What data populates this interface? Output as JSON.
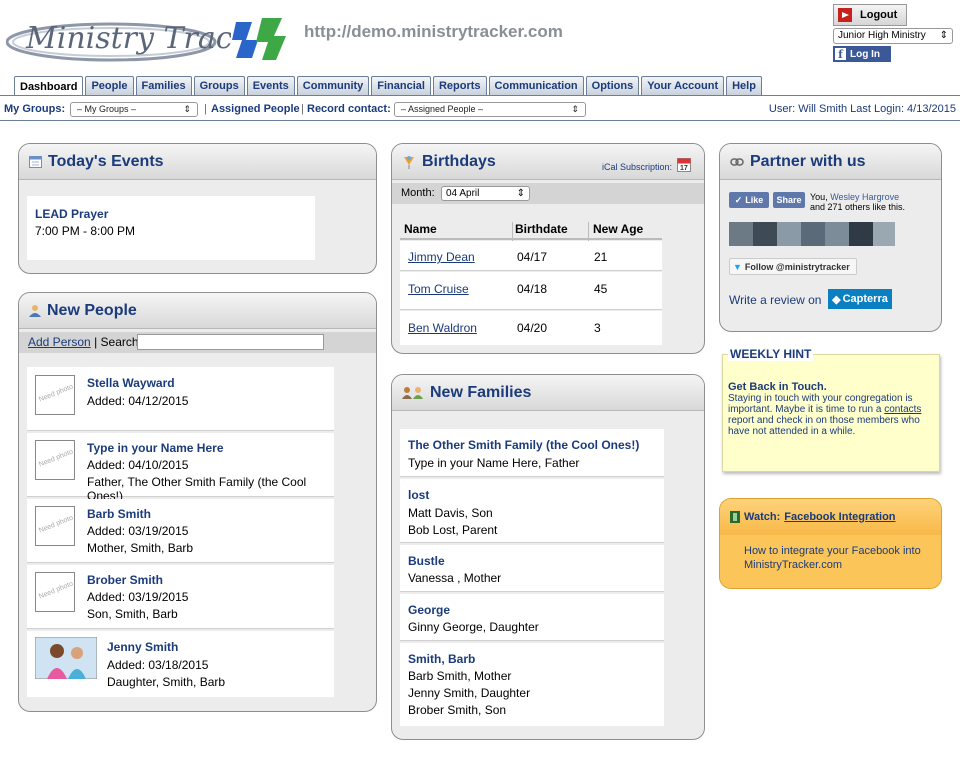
{
  "header": {
    "logo_text": "Ministry Tracker",
    "site_url": "http://demo.ministrytracker.com",
    "logout_label": "Logout",
    "ministry_selected": "Junior High Ministry",
    "fb_login_label": "Log In",
    "fb_icon_letter": "f"
  },
  "tabs": [
    "Dashboard",
    "People",
    "Families",
    "Groups",
    "Events",
    "Community",
    "Financial",
    "Reports",
    "Communication",
    "Options",
    "Your Account",
    "Help"
  ],
  "groupbar": {
    "my_groups_label": "My Groups:",
    "my_groups_value": "– My Groups –",
    "assigned_people": "Assigned People",
    "record_contact_label": "Record contact:",
    "record_contact_value": "– Assigned People –",
    "user_info": "User: Will Smith Last Login: 4/13/2015"
  },
  "todays_events": {
    "title": "Today's Events",
    "event_name": "LEAD Prayer",
    "event_time": "7:00 PM - 8:00 PM"
  },
  "new_people": {
    "title": "New People",
    "add_person": "Add Person",
    "search_label": "| Search:",
    "need_photo": "Need photo",
    "items": [
      {
        "name": "Stella Wayward",
        "added": "Added: 04/12/2015",
        "rel": ""
      },
      {
        "name": "Type in your Name Here",
        "added": "Added: 04/10/2015",
        "rel": "Father, The Other Smith Family (the Cool Ones!)"
      },
      {
        "name": "Barb Smith",
        "added": "Added: 03/19/2015",
        "rel": "Mother, Smith, Barb"
      },
      {
        "name": "Brober Smith",
        "added": "Added: 03/19/2015",
        "rel": "Son, Smith, Barb"
      },
      {
        "name": "Jenny Smith",
        "added": "Added: 03/18/2015",
        "rel": "Daughter, Smith, Barb"
      }
    ]
  },
  "birthdays": {
    "title": "Birthdays",
    "ical": "iCal Subscription:",
    "month_label": "Month:",
    "month_value": "04 April",
    "headers": [
      "Name",
      "Birthdate",
      "New Age"
    ],
    "rows": [
      {
        "name": "Jimmy Dean",
        "date": "04/17",
        "age": "21"
      },
      {
        "name": "Tom Cruise",
        "date": "04/18",
        "age": "45"
      },
      {
        "name": "Ben Waldron",
        "date": "04/20",
        "age": "3"
      }
    ]
  },
  "new_families": {
    "title": "New Families",
    "items": [
      {
        "name": "The Other Smith Family (the Cool Ones!)",
        "lines": [
          "Type in your Name Here, Father"
        ]
      },
      {
        "name": "lost",
        "lines": [
          "Matt Davis, Son",
          "Bob Lost, Parent"
        ]
      },
      {
        "name": "Bustle",
        "lines": [
          "Vanessa , Mother"
        ]
      },
      {
        "name": "George",
        "lines": [
          "Ginny George, Daughter"
        ]
      },
      {
        "name": "Smith, Barb",
        "lines": [
          "Barb Smith, Mother",
          "Jenny Smith, Daughter",
          "Brober Smith, Son"
        ]
      }
    ]
  },
  "partner": {
    "title": "Partner with us",
    "like": "Like",
    "share": "Share",
    "you": "You,",
    "friend": "Wesley Hargrove",
    "others": "and 271 others like this.",
    "follow": "Follow @ministrytracker",
    "review": "Write a review on",
    "capterra": "Capterra"
  },
  "weekly_hint": {
    "title": "WEEKLY HINT",
    "heading": "Get Back in Touch.",
    "text1": "Staying in touch with your congregation is important. Maybe it is time to run a",
    "link": "contacts",
    "text2": "report and check in on those members who have not attended in a while."
  },
  "watch": {
    "label": "Watch:",
    "link": "Facebook Integration",
    "desc": "How to integrate your Facebook into MinistryTracker.com"
  },
  "colors": {
    "accent": "#1b3b7b",
    "hint_bg": "#ffffcc",
    "watch_bg": "#fbc55a"
  }
}
